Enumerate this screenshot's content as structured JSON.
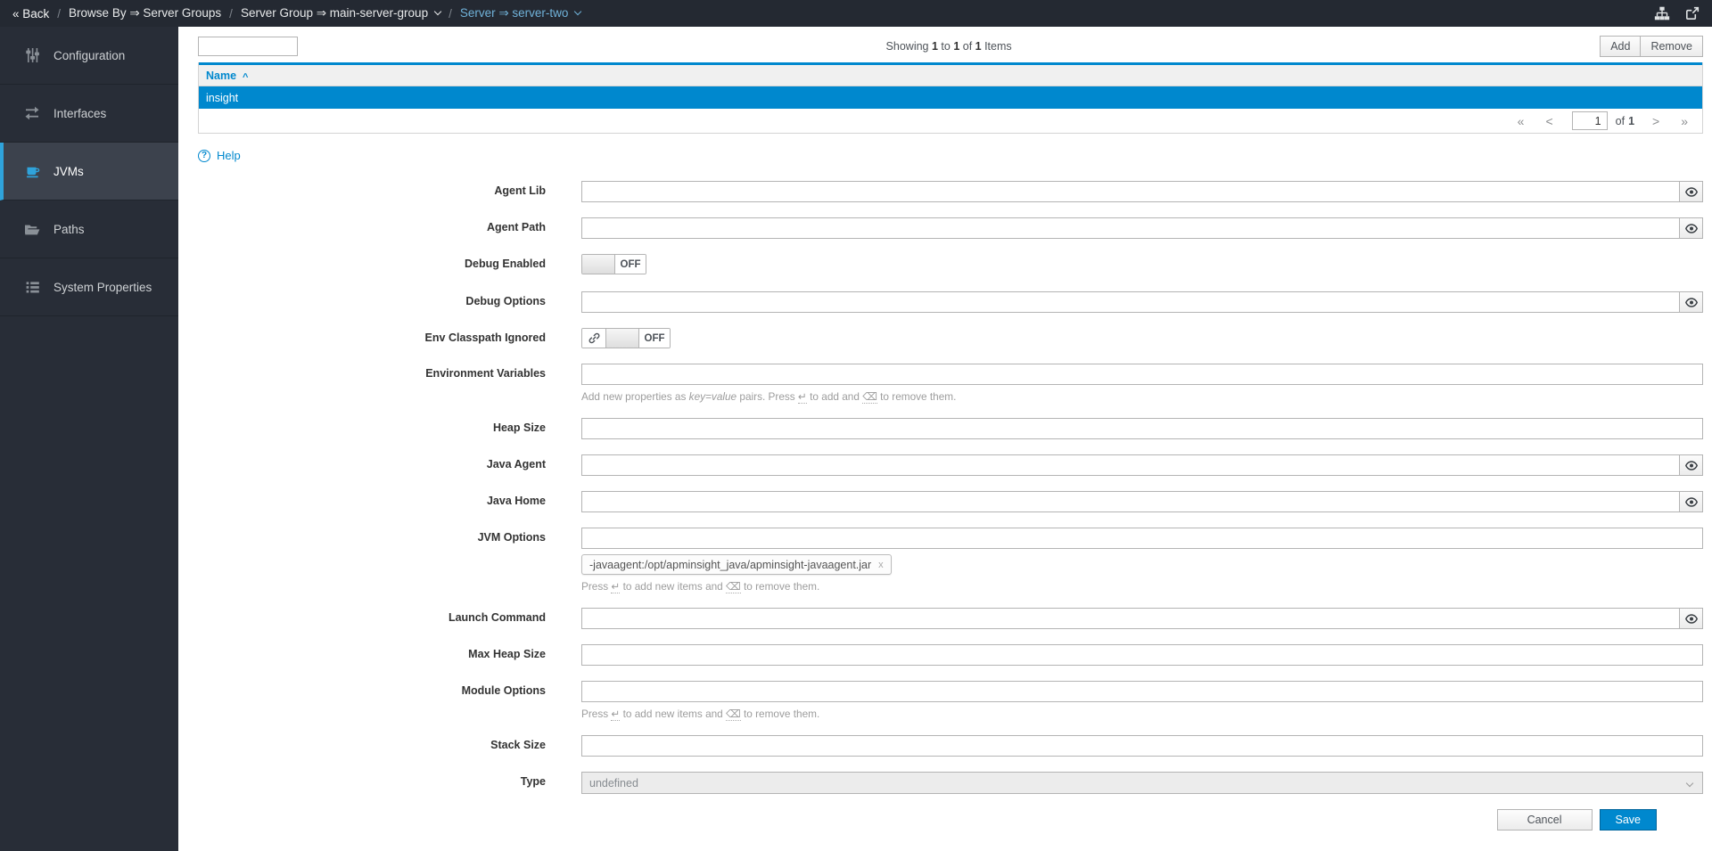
{
  "topnav": {
    "back_label": "« Back",
    "separator": "/",
    "breadcrumb": [
      {
        "label": "Browse By ⇒ Server Groups",
        "caret": false,
        "active": false
      },
      {
        "label": "Server Group ⇒ main-server-group",
        "caret": true,
        "active": false
      },
      {
        "label": "Server ⇒ server-two",
        "caret": true,
        "active": true
      }
    ],
    "icons": [
      {
        "name": "topology-icon"
      },
      {
        "name": "external-link-icon"
      }
    ]
  },
  "sidebar": {
    "items": [
      {
        "label": "Configuration",
        "icon": "sliders-icon",
        "active": false
      },
      {
        "label": "Interfaces",
        "icon": "exchange-icon",
        "active": false
      },
      {
        "label": "JVMs",
        "icon": "coffee-icon",
        "active": true
      },
      {
        "label": "Paths",
        "icon": "folder-open-icon",
        "active": false
      },
      {
        "label": "System Properties",
        "icon": "list-icon",
        "active": false
      }
    ]
  },
  "table": {
    "search_value": "",
    "showing": [
      {
        "t": "Showing "
      },
      {
        "t": "1",
        "b": true
      },
      {
        "t": " to "
      },
      {
        "t": "1",
        "b": true
      },
      {
        "t": " of "
      },
      {
        "t": "1",
        "b": true
      },
      {
        "t": " Items"
      }
    ],
    "add_label": "Add",
    "remove_label": "Remove",
    "column_name": "Name",
    "sort_glyph": "^",
    "rows": [
      {
        "name": "insight",
        "selected": true
      }
    ],
    "pager": {
      "first": "«",
      "prev": "<",
      "page_value": "1",
      "of_label": "of",
      "total": "1",
      "next": ">",
      "last": "»"
    }
  },
  "help": {
    "label": "Help",
    "glyph": "?"
  },
  "form": {
    "rows": [
      {
        "id": "agent-lib",
        "label": "Agent Lib",
        "type": "text",
        "value": "",
        "eye": true
      },
      {
        "id": "agent-path",
        "label": "Agent Path",
        "type": "text",
        "value": "",
        "eye": true
      },
      {
        "id": "debug-enabled",
        "label": "Debug Enabled",
        "type": "toggle",
        "state_label": "OFF"
      },
      {
        "id": "debug-options",
        "label": "Debug Options",
        "type": "text",
        "value": "",
        "eye": true
      },
      {
        "id": "env-classpath-ignored",
        "label": "Env Classpath Ignored",
        "type": "toggle",
        "state_label": "OFF",
        "link_icon": true
      },
      {
        "id": "environment-variables",
        "label": "Environment Variables",
        "type": "text",
        "value": "",
        "helper": [
          {
            "t": "Add new properties as "
          },
          {
            "t": "key=value",
            "i": true
          },
          {
            "t": " pairs. Press "
          },
          {
            "t": "↵",
            "k": true
          },
          {
            "t": " to add and "
          },
          {
            "t": "⌫",
            "k": true
          },
          {
            "t": " to remove them."
          }
        ]
      },
      {
        "id": "heap-size",
        "label": "Heap Size",
        "type": "text",
        "value": ""
      },
      {
        "id": "java-agent",
        "label": "Java Agent",
        "type": "text",
        "value": "",
        "eye": true
      },
      {
        "id": "java-home",
        "label": "Java Home",
        "type": "text",
        "value": "",
        "eye": true
      },
      {
        "id": "jvm-options",
        "label": "JVM Options",
        "type": "text",
        "value": "",
        "tags": [
          {
            "text": "-javaagent:/opt/apminsight_java/apminsight-javaagent.jar",
            "remove_label": "x"
          }
        ],
        "helper": [
          {
            "t": "Press "
          },
          {
            "t": "↵",
            "k": true
          },
          {
            "t": " to add new items and "
          },
          {
            "t": "⌫",
            "k": true
          },
          {
            "t": " to remove them."
          }
        ]
      },
      {
        "id": "launch-command",
        "label": "Launch Command",
        "type": "text",
        "value": "",
        "eye": true
      },
      {
        "id": "max-heap-size",
        "label": "Max Heap Size",
        "type": "text",
        "value": ""
      },
      {
        "id": "module-options",
        "label": "Module Options",
        "type": "text",
        "value": "",
        "helper": [
          {
            "t": "Press "
          },
          {
            "t": "↵",
            "k": true
          },
          {
            "t": " to add new items and "
          },
          {
            "t": "⌫",
            "k": true
          },
          {
            "t": " to remove them."
          }
        ]
      },
      {
        "id": "stack-size",
        "label": "Stack Size",
        "type": "text",
        "value": ""
      },
      {
        "id": "type",
        "label": "Type",
        "type": "select",
        "value": "undefined"
      }
    ]
  },
  "buttons": {
    "cancel": "Cancel",
    "save": "Save"
  },
  "colors": {
    "accent_blue": "#0088ce",
    "nav_active_blue": "#2fa3db",
    "selected_row": "#0088ce"
  }
}
